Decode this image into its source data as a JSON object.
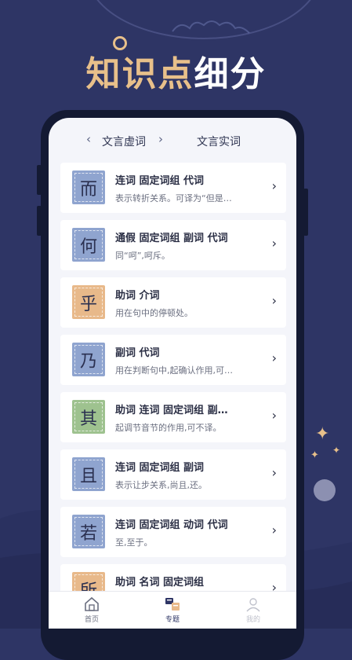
{
  "headline": {
    "part1": "知识",
    "part2": "点",
    "part3": "细分"
  },
  "tabs": {
    "left_arrow": "‹",
    "active": "文言虚词",
    "right_arrow": "›",
    "other": "文言实词"
  },
  "items": [
    {
      "char": "而",
      "title": "连词 固定词组 代词",
      "desc": "表示转折关系。可译为“但是…",
      "color": "#8fa4cf"
    },
    {
      "char": "何",
      "title": "通假 固定词组 副词 代词",
      "desc": "同“呵”,呵斥。",
      "color": "#8fa4cf"
    },
    {
      "char": "乎",
      "title": "助词 介词",
      "desc": "用在句中的停顿处。",
      "color": "#e8b98a"
    },
    {
      "char": "乃",
      "title": "副词 代词",
      "desc": "用在判断句中,起确认作用,可…",
      "color": "#8fa4cf"
    },
    {
      "char": "其",
      "title": "助词 连词 固定词组 副…",
      "desc": "起调节音节的作用,可不译。",
      "color": "#9ec28f"
    },
    {
      "char": "且",
      "title": "连词 固定词组 副词",
      "desc": "表示让步关系,尚且,还。",
      "color": "#8fa4cf"
    },
    {
      "char": "若",
      "title": "连词 固定词组 动词 代词",
      "desc": "至,至于。",
      "color": "#8fa4cf"
    },
    {
      "char": "所",
      "title": "助词 名词 固定词组",
      "desc": "",
      "color": "#e8b98a"
    }
  ],
  "tabbar": {
    "home": "首页",
    "topics": "专题",
    "mine": "我的"
  },
  "colors": {
    "background": "#2e3565",
    "accent": "#e8c08a"
  }
}
